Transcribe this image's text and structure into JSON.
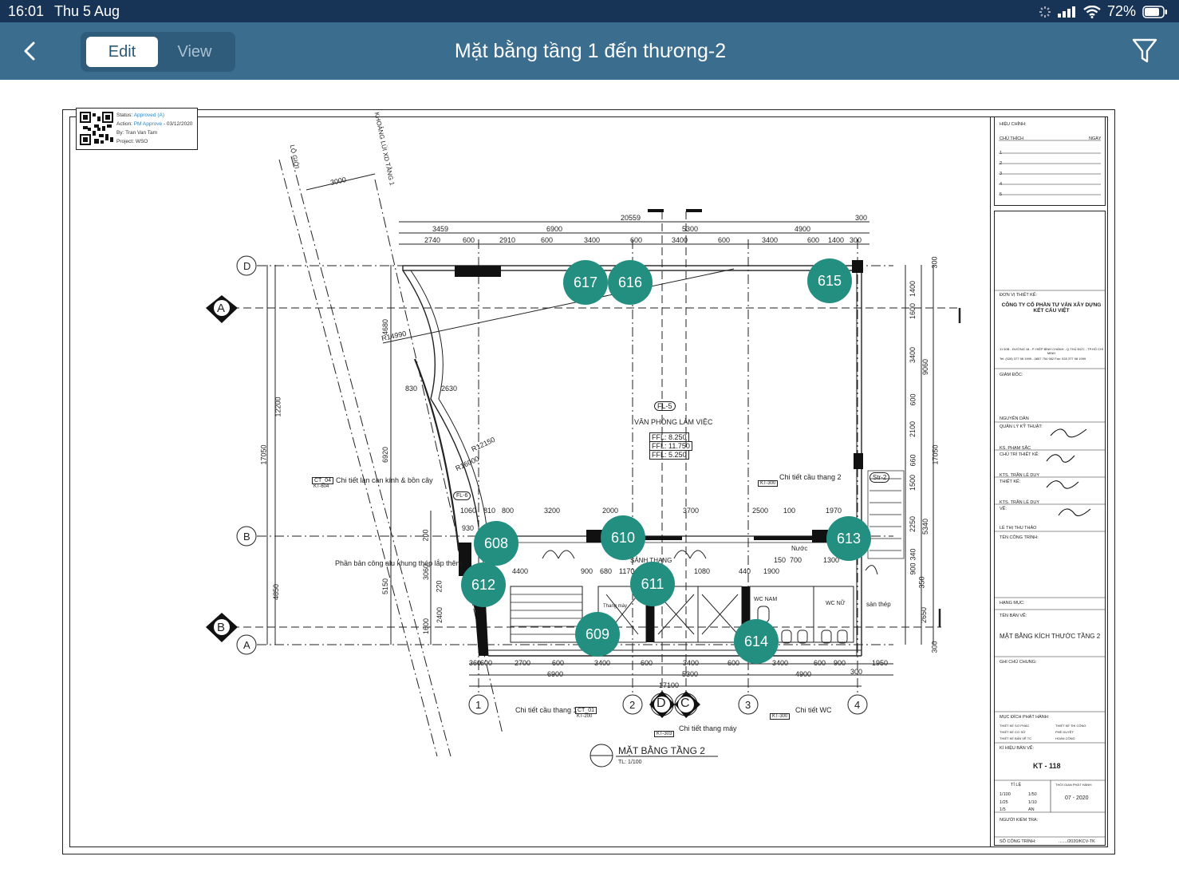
{
  "status_bar": {
    "time": "16:01",
    "date": "Thu 5 Aug",
    "battery": "72%"
  },
  "nav": {
    "title": "Mặt bằng tầng 1 đến thương-2",
    "tabs": {
      "edit": "Edit",
      "view": "View"
    },
    "active_tab": "Edit",
    "back_icon": "chevron-left-icon",
    "filter_icon": "filter-icon"
  },
  "stamp": {
    "status_label": "Status:",
    "status_value": "Approved (A)",
    "action_label": "Action:",
    "action_value": "PM Approve",
    "action_date": "- 03/12/2020",
    "by": "By: Tran Van Tam",
    "project": "Project: WSO"
  },
  "markers": [
    {
      "label": "617"
    },
    {
      "label": "616"
    },
    {
      "label": "615"
    },
    {
      "label": "610"
    },
    {
      "label": "608"
    },
    {
      "label": "613"
    },
    {
      "label": "612"
    },
    {
      "label": "611"
    },
    {
      "label": "609"
    },
    {
      "label": "614"
    }
  ],
  "drawing": {
    "top_dims": [
      "3459",
      "6900",
      "20559",
      "5300",
      "4900",
      "300"
    ],
    "top_subdims": [
      "2740",
      "600",
      "2910",
      "600",
      "3400",
      "600",
      "3400",
      "600",
      "3400",
      "600",
      "1400",
      "300"
    ],
    "bottom_dims": [
      "360",
      "600",
      "2700",
      "600",
      "3400",
      "600",
      "3400",
      "600",
      "3400",
      "600",
      "900",
      "1950"
    ],
    "bottom_totals": [
      "6900",
      "5300",
      "4900",
      "300",
      "17100"
    ],
    "left_dims": [
      "12200",
      "17050",
      "4680",
      "6920",
      "4850",
      "5150",
      "3060",
      "2400",
      "1600",
      "200",
      "220"
    ],
    "right_dims": [
      "300",
      "1400",
      "1600",
      "3400",
      "9060",
      "600",
      "2100",
      "660",
      "17050",
      "1500",
      "2250",
      "5340",
      "340",
      "900",
      "350",
      "2650",
      "300"
    ],
    "grid_labels": [
      "D",
      "A",
      "B",
      "B",
      "A",
      "1",
      "2",
      "3",
      "4",
      "D",
      "C"
    ],
    "room_label": "VĂN PHÒNG LÀM VIỆC",
    "room_tag": "FL-5",
    "ffl": [
      "FFL: 8.250",
      "FFL: 11.750",
      "FFL: 5.250"
    ],
    "annotations": [
      "Chi tiết lan can kính & bồn cây",
      "Phần bản công alu khung thép lắp thêm",
      "Chi tiết cầu thang 2",
      "Chi tiết cầu thang 1",
      "Chi tiết thang máy",
      "Chi tiết WC",
      "SẢNH THANG",
      "WC NAM",
      "WC NỮ",
      "sàn thép",
      "Nước",
      "Thang máy",
      "KHOẢNG LÙI XD TẦNG 1",
      "LỘ GIỚI",
      "3000",
      "R14990",
      "R12150",
      "R16000",
      "830",
      "2630",
      "1060",
      "810",
      "800",
      "3200",
      "2000",
      "3700",
      "2500",
      "100",
      "1970",
      "930",
      "4400",
      "900",
      "680",
      "1170",
      "1080",
      "440",
      "1900",
      "1300",
      "150",
      "700"
    ],
    "detail_refs": [
      "CT_04",
      "KT-604",
      "FL-6",
      "Str-2",
      "KT-300",
      "CT_01",
      "KT-200",
      "KT-303",
      "KT-300"
    ],
    "plan_title": "MẶT BẰNG TẦNG 2",
    "plan_scale": "TL: 1/100"
  },
  "title_block": {
    "revision_header": "HIỆU CHỈNH:",
    "revision_cols": [
      "CHỦ THÍCH",
      "NGÀY"
    ],
    "revision_rows": [
      "1",
      "2",
      "3",
      "4",
      "5"
    ],
    "designer_label": "ĐƠN VỊ THIẾT KẾ:",
    "company": "CÔNG TY CỔ PHẦN TƯ VẤN XÂY DỰNG KẾT CẤU VIỆT",
    "address": "11 50B - ĐƯỜNG 18 - P. HIỆP BÌNH CHÁNH - Q.THỦ ĐỨC - TP.HỒ CHÍ MINH",
    "phone": "Tel: (028) 377 98 1999 - 0857 754 982     Fax: 028 377 98 1999",
    "director_label": "GIÁM ĐỐC:",
    "director_name": "NGUYỄN DÂN",
    "qa_label": "QUẢN LÝ KỸ THUẬT:",
    "qa_name": "KS. PHẠM SẮC",
    "chief_label": "CHỦ TRÌ THIẾT KẾ:",
    "chief_name": "KTS. TRẦN LÊ DUY",
    "design_label": "THIẾT KẾ:",
    "design_name": "KTS. TRẦN LÊ DUY",
    "drawn_label": "VẼ:",
    "drawn_name": "LÊ THỊ THU THẢO",
    "project_label": "TÊN CÔNG TRÌNH:",
    "item_label": "HẠNG MỤC:",
    "sheet_name_label": "TÊN BẢN VẼ:",
    "sheet_name": "MẶT BẰNG KÍCH THƯỚC TẦNG 2",
    "notes_label": "GHI CHÚ CHUNG:",
    "purpose_label": "MỤC ĐÍCH PHÁT HÀNH:",
    "purposes": [
      "THIẾT KẾ SƠ PHÁC",
      "THIẾT KẾ CƠ SỞ",
      "THIẾT KẾ BẢN VẼ TC",
      "THIẾT KẾ THI CÔNG",
      "PHÊ DUYỆT",
      "HOÀN CÔNG"
    ],
    "sheet_no_label": "KÍ HIỆU BẢN VẼ:",
    "sheet_no": "KT - 118",
    "scale_label": "TỈ LỆ",
    "scales": [
      "1/100",
      "1/50",
      "1/25",
      "1/10",
      "1/5",
      "AN"
    ],
    "date_label": "THỜI GIAN PHÁT HÀNH:",
    "date": "07 - 2020",
    "checker_label": "NGƯỜI KIỂM TRA:",
    "doc_no_label": "SỐ CÔNG TRÌNH:",
    "doc_no": "......./2020/KCV-TK"
  }
}
